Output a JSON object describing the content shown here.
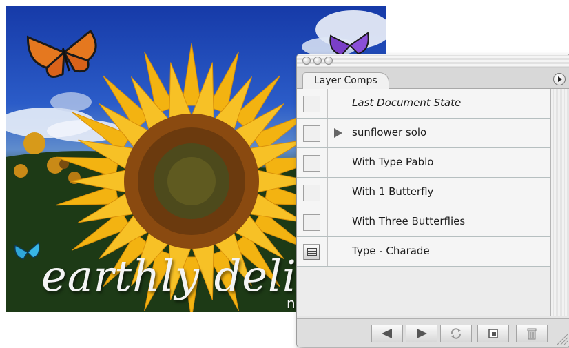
{
  "document": {
    "title_text": "earthly delig",
    "subtitle_text": "n"
  },
  "palette": {
    "tab_label": "Layer Comps",
    "comps": [
      {
        "name": "Last Document State",
        "checked": false,
        "expand_arrow": false,
        "italic": true
      },
      {
        "name": "sunflower solo",
        "checked": false,
        "expand_arrow": true,
        "italic": false
      },
      {
        "name": "With Type Pablo",
        "checked": false,
        "expand_arrow": false,
        "italic": false
      },
      {
        "name": "With 1 Butterfly",
        "checked": false,
        "expand_arrow": false,
        "italic": false
      },
      {
        "name": "With Three Butterflies",
        "checked": false,
        "expand_arrow": false,
        "italic": false
      },
      {
        "name": "Type - Charade",
        "checked": true,
        "expand_arrow": false,
        "italic": false
      }
    ],
    "buttons": [
      {
        "icon": "previous-arrow-icon"
      },
      {
        "icon": "next-arrow-icon"
      },
      {
        "icon": "update-refresh-icon"
      },
      {
        "icon": "new-comp-icon"
      },
      {
        "icon": "trash-icon"
      }
    ]
  }
}
